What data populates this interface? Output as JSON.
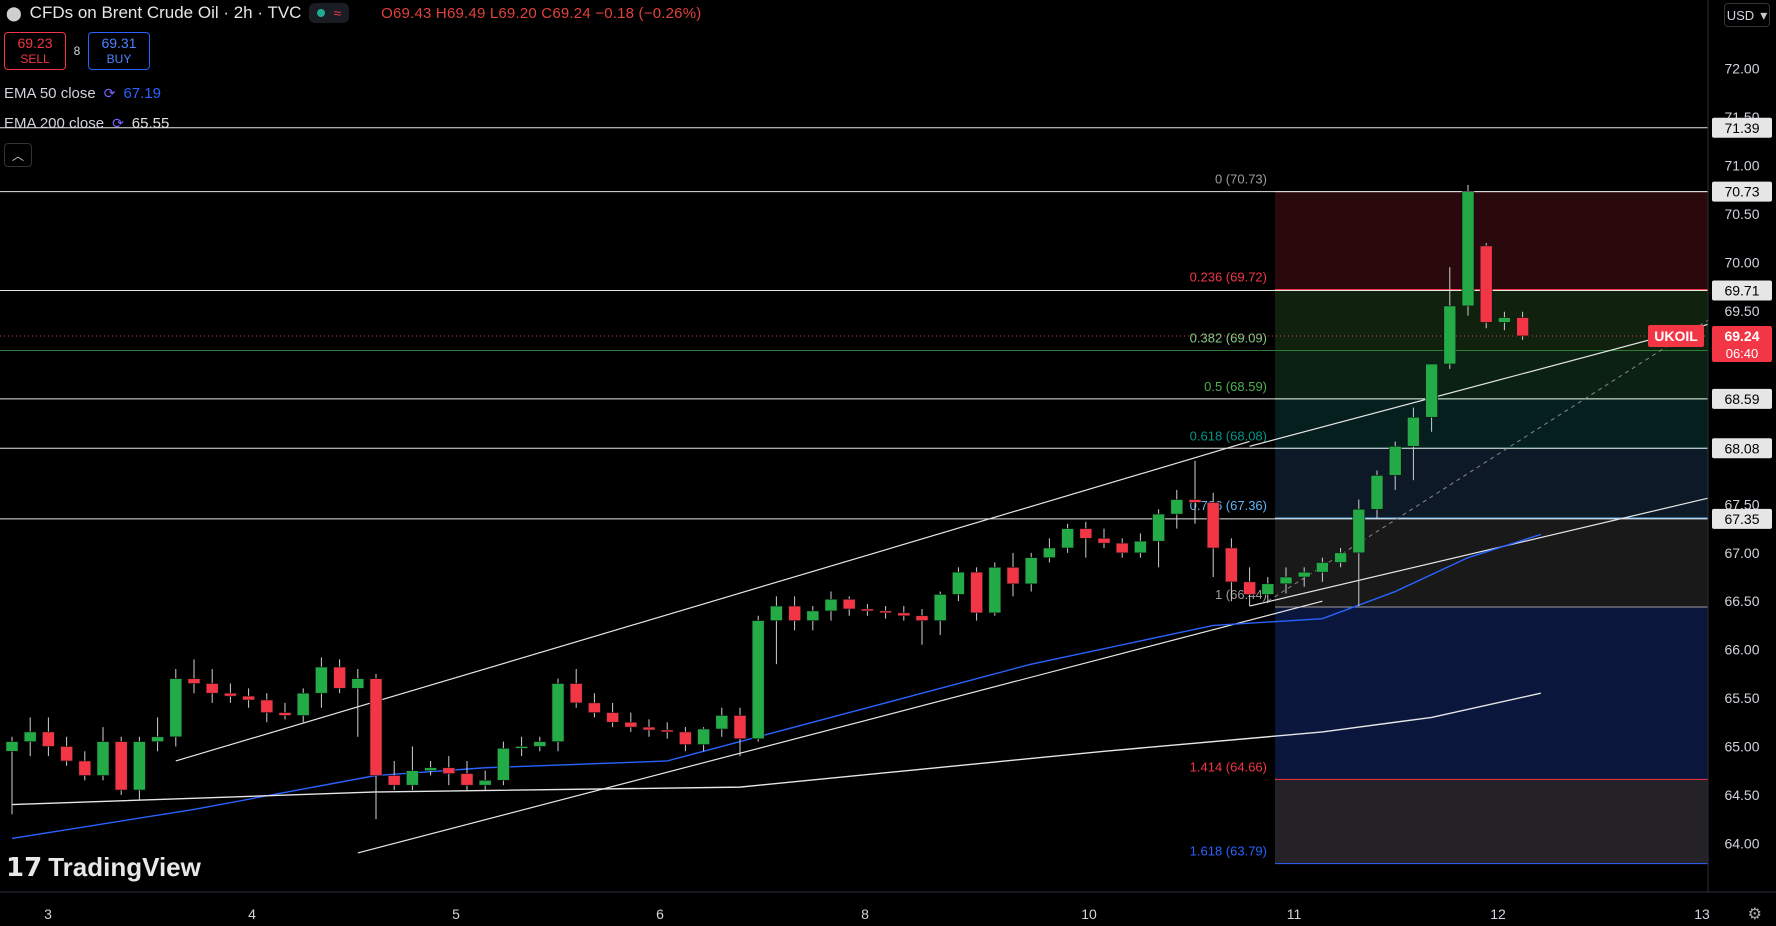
{
  "header": {
    "title": "CFDs on Brent Crude Oil · 2h · TVC",
    "ohlc": "O69.43 H69.49 L69.20 C69.24 −0.18 (−0.26%)",
    "waves_icon": "≈"
  },
  "trade": {
    "sell_price": "69.23",
    "sell_label": "SELL",
    "spread": "8",
    "buy_price": "69.31",
    "buy_label": "BUY"
  },
  "indicators": {
    "ema50_label": "EMA 50 close",
    "ema50_value": "67.19",
    "ema200_label": "EMA 200 close",
    "ema200_value": "65.55"
  },
  "currency": "USD",
  "logo_text": "TradingView",
  "colors": {
    "up": "#22ab46",
    "down": "#f23645",
    "ema50": "#2962ff",
    "ema200": "#e6e6e6"
  },
  "chart_data": {
    "type": "candlestick",
    "symbol": "UKOIL",
    "interval": "2h",
    "ylim": [
      63.6,
      72.4
    ],
    "y_ticks": [
      "72.00",
      "71.50",
      "71.00",
      "70.50",
      "70.00",
      "69.50",
      "67.50",
      "67.00",
      "66.50",
      "66.00",
      "65.50",
      "65.00",
      "64.50",
      "64.00"
    ],
    "x_ticks": [
      "3",
      "4",
      "5",
      "6",
      "8",
      "10",
      "11",
      "12",
      "13"
    ],
    "candles": [
      [
        64.95,
        65.1,
        64.3,
        65.05
      ],
      [
        65.05,
        65.3,
        64.9,
        65.15
      ],
      [
        65.15,
        65.3,
        64.9,
        65.0
      ],
      [
        65.0,
        65.1,
        64.8,
        64.85
      ],
      [
        64.85,
        64.95,
        64.65,
        64.7
      ],
      [
        64.7,
        65.2,
        64.65,
        65.05
      ],
      [
        65.05,
        65.1,
        64.5,
        64.55
      ],
      [
        64.55,
        65.1,
        64.45,
        65.05
      ],
      [
        65.05,
        65.3,
        64.95,
        65.1
      ],
      [
        65.1,
        65.8,
        65.0,
        65.7
      ],
      [
        65.7,
        65.9,
        65.55,
        65.65
      ],
      [
        65.65,
        65.8,
        65.45,
        65.55
      ],
      [
        65.55,
        65.65,
        65.45,
        65.52
      ],
      [
        65.52,
        65.6,
        65.4,
        65.48
      ],
      [
        65.48,
        65.55,
        65.25,
        65.35
      ],
      [
        65.35,
        65.45,
        65.28,
        65.32
      ],
      [
        65.32,
        65.6,
        65.25,
        65.55
      ],
      [
        65.55,
        65.92,
        65.4,
        65.82
      ],
      [
        65.82,
        65.9,
        65.55,
        65.6
      ],
      [
        65.6,
        65.8,
        65.1,
        65.7
      ],
      [
        65.7,
        65.75,
        64.25,
        64.7
      ],
      [
        64.7,
        64.85,
        64.55,
        64.6
      ],
      [
        64.6,
        65.0,
        64.55,
        64.75
      ],
      [
        64.75,
        64.85,
        64.7,
        64.78
      ],
      [
        64.78,
        64.9,
        64.6,
        64.72
      ],
      [
        64.72,
        64.85,
        64.55,
        64.6
      ],
      [
        64.6,
        64.75,
        64.55,
        64.65
      ],
      [
        64.65,
        65.05,
        64.6,
        64.98
      ],
      [
        64.98,
        65.1,
        64.9,
        65.0
      ],
      [
        65.0,
        65.1,
        64.95,
        65.05
      ],
      [
        65.05,
        65.7,
        64.95,
        65.65
      ],
      [
        65.65,
        65.8,
        65.4,
        65.45
      ],
      [
        65.45,
        65.55,
        65.3,
        65.35
      ],
      [
        65.35,
        65.45,
        65.2,
        65.25
      ],
      [
        65.25,
        65.35,
        65.15,
        65.2
      ],
      [
        65.2,
        65.28,
        65.1,
        65.17
      ],
      [
        65.17,
        65.25,
        65.08,
        65.15
      ],
      [
        65.15,
        65.2,
        64.95,
        65.02
      ],
      [
        65.02,
        65.2,
        64.95,
        65.18
      ],
      [
        65.18,
        65.4,
        65.1,
        65.32
      ],
      [
        65.32,
        65.4,
        64.9,
        65.08
      ],
      [
        65.08,
        66.35,
        65.05,
        66.3
      ],
      [
        66.3,
        66.55,
        65.85,
        66.45
      ],
      [
        66.45,
        66.55,
        66.2,
        66.3
      ],
      [
        66.3,
        66.45,
        66.2,
        66.4
      ],
      [
        66.4,
        66.6,
        66.3,
        66.52
      ],
      [
        66.52,
        66.55,
        66.35,
        66.42
      ],
      [
        66.42,
        66.47,
        66.35,
        66.4
      ],
      [
        66.4,
        66.45,
        66.32,
        66.38
      ],
      [
        66.38,
        66.45,
        66.3,
        66.35
      ],
      [
        66.35,
        66.42,
        66.05,
        66.3
      ],
      [
        66.3,
        66.6,
        66.15,
        66.57
      ],
      [
        66.57,
        66.85,
        66.5,
        66.8
      ],
      [
        66.8,
        66.85,
        66.3,
        66.38
      ],
      [
        66.38,
        66.9,
        66.35,
        66.85
      ],
      [
        66.85,
        67.0,
        66.55,
        66.68
      ],
      [
        66.68,
        67.0,
        66.6,
        66.95
      ],
      [
        66.95,
        67.15,
        66.9,
        67.05
      ],
      [
        67.05,
        67.3,
        67.0,
        67.25
      ],
      [
        67.25,
        67.32,
        66.95,
        67.15
      ],
      [
        67.15,
        67.25,
        67.05,
        67.1
      ],
      [
        67.1,
        67.15,
        66.95,
        67.0
      ],
      [
        67.0,
        67.2,
        66.95,
        67.12
      ],
      [
        67.12,
        67.45,
        66.85,
        67.4
      ],
      [
        67.4,
        67.65,
        67.25,
        67.55
      ],
      [
        67.55,
        67.95,
        67.3,
        67.52
      ],
      [
        67.52,
        67.62,
        66.75,
        67.05
      ],
      [
        67.05,
        67.15,
        66.5,
        66.7
      ],
      [
        66.7,
        66.85,
        66.45,
        66.57
      ],
      [
        66.57,
        66.75,
        66.48,
        66.68
      ],
      [
        66.68,
        66.85,
        66.58,
        66.75
      ],
      [
        66.75,
        66.85,
        66.65,
        66.8
      ],
      [
        66.8,
        66.95,
        66.7,
        66.9
      ],
      [
        66.9,
        67.05,
        66.85,
        67.0
      ],
      [
        67.0,
        67.55,
        66.45,
        67.45
      ],
      [
        67.45,
        67.85,
        67.35,
        67.8
      ],
      [
        67.8,
        68.15,
        67.65,
        68.1
      ],
      [
        68.1,
        68.5,
        67.75,
        68.4
      ],
      [
        68.4,
        68.95,
        68.25,
        68.95
      ],
      [
        68.95,
        69.95,
        68.9,
        69.55
      ],
      [
        69.55,
        70.8,
        69.45,
        70.73
      ],
      [
        70.17,
        70.2,
        69.32,
        69.38
      ],
      [
        69.38,
        69.49,
        69.3,
        69.43
      ],
      [
        69.43,
        69.49,
        69.2,
        69.24
      ]
    ],
    "ema50": [
      [
        0,
        64.05
      ],
      [
        10,
        64.35
      ],
      [
        20,
        64.7
      ],
      [
        26,
        64.78
      ],
      [
        36,
        64.85
      ],
      [
        46,
        65.35
      ],
      [
        56,
        65.85
      ],
      [
        66,
        66.25
      ],
      [
        72,
        66.32
      ],
      [
        76,
        66.6
      ],
      [
        80,
        66.95
      ],
      [
        84,
        67.19
      ]
    ],
    "ema200": [
      [
        0,
        64.4
      ],
      [
        20,
        64.53
      ],
      [
        40,
        64.58
      ],
      [
        60,
        64.95
      ],
      [
        72,
        65.15
      ],
      [
        78,
        65.3
      ],
      [
        84,
        65.55
      ]
    ],
    "trendlines": [
      {
        "from": [
          9,
          64.85
        ],
        "to": [
          68,
          68.15
        ]
      },
      {
        "from": [
          19,
          63.9
        ],
        "to": [
          72,
          66.5
        ]
      },
      {
        "from": [
          68,
          66.45
        ],
        "to": [
          94,
          67.6
        ]
      },
      {
        "from": [
          68,
          68.1
        ],
        "to": [
          94,
          69.4
        ]
      }
    ],
    "horizontal_levels": [
      "71.39",
      "70.73",
      "69.71",
      "68.59",
      "68.08",
      "67.35"
    ],
    "green_level": "69.09",
    "fibonacci": {
      "levels": [
        {
          "label": "0 (70.73)",
          "price": 70.73,
          "color": "#9b9b9b"
        },
        {
          "label": "0.236 (69.72)",
          "price": 69.72,
          "color": "#f23645"
        },
        {
          "label": "0.382 (69.09)",
          "price": 69.09,
          "color": "#81c784"
        },
        {
          "label": "0.5 (68.59)",
          "price": 68.59,
          "color": "#4caf50"
        },
        {
          "label": "0.618 (68.08)",
          "price": 68.08,
          "color": "#009688"
        },
        {
          "label": "0.786 (67.36)",
          "price": 67.36,
          "color": "#64b5f6"
        },
        {
          "label": "1 (66.44)",
          "price": 66.44,
          "color": "#9b9b9b"
        },
        {
          "label": "1.414 (64.66)",
          "price": 64.66,
          "color": "#f23645"
        },
        {
          "label": "1.618 (63.79)",
          "price": 63.79,
          "color": "#2962ff"
        }
      ]
    },
    "last_price": {
      "symbol": "UKOIL",
      "price": "69.24",
      "countdown": "06:40"
    }
  }
}
